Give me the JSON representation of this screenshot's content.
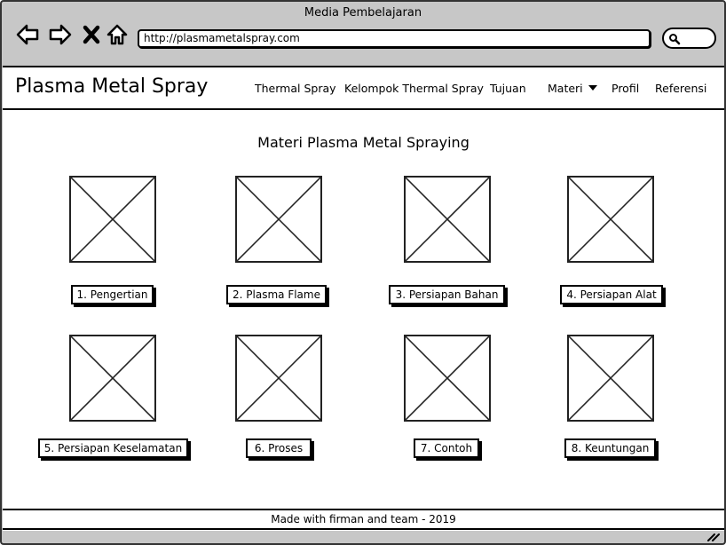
{
  "window": {
    "title": "Media Pembelajaran"
  },
  "browser": {
    "url": "http://plasmametalspray.com",
    "icons": [
      "back-arrow-icon",
      "forward-arrow-icon",
      "close-icon",
      "home-icon",
      "search-icon"
    ]
  },
  "header": {
    "brand": "Plasma Metal Spray",
    "nav": [
      {
        "label": "Thermal Spray"
      },
      {
        "label": "Kelompok Thermal Spray"
      },
      {
        "label": "Tujuan"
      },
      {
        "label": "Materi",
        "dropdown": true
      },
      {
        "label": "Profil"
      },
      {
        "label": "Referensi"
      }
    ]
  },
  "main": {
    "title": "Materi Plasma Metal Spraying",
    "items": [
      {
        "label": "1. Pengertian"
      },
      {
        "label": "2. Plasma Flame"
      },
      {
        "label": "3. Persiapan Bahan"
      },
      {
        "label": "4. Persiapan Alat"
      },
      {
        "label": "5. Persiapan Keselamatan"
      },
      {
        "label": "6. Proses"
      },
      {
        "label": "7. Contoh"
      },
      {
        "label": "8. Keuntungan"
      }
    ]
  },
  "footer": {
    "text": "Made with firman and team - 2019"
  }
}
